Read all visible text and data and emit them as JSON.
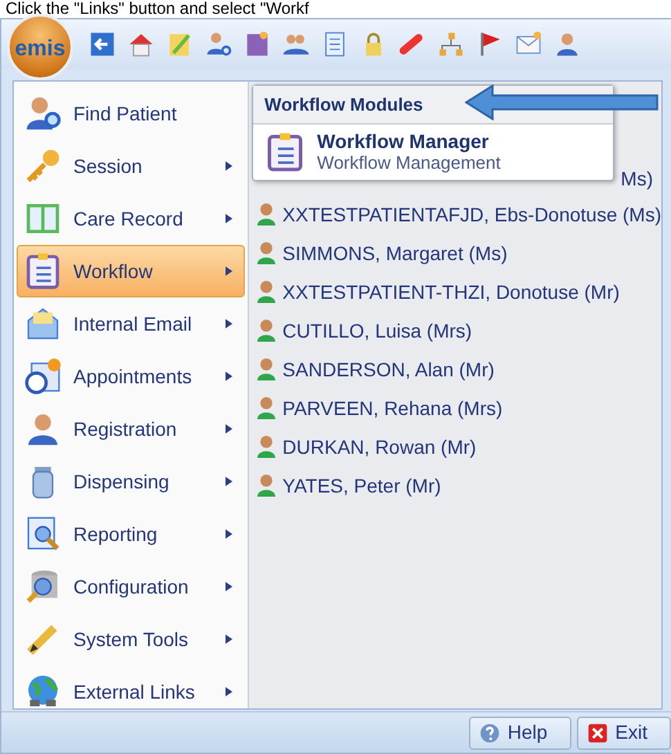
{
  "caption": "Click the \"Links\" button and select \"Workf",
  "logo": {
    "text": "emis"
  },
  "menu": [
    {
      "label": "Find Patient",
      "submenu": false,
      "selected": false
    },
    {
      "label": "Session",
      "submenu": true,
      "selected": false
    },
    {
      "label": "Care Record",
      "submenu": true,
      "selected": false
    },
    {
      "label": "Workflow",
      "submenu": true,
      "selected": true
    },
    {
      "label": "Internal Email",
      "submenu": true,
      "selected": false
    },
    {
      "label": "Appointments",
      "submenu": true,
      "selected": false
    },
    {
      "label": "Registration",
      "submenu": true,
      "selected": false
    },
    {
      "label": "Dispensing",
      "submenu": true,
      "selected": false
    },
    {
      "label": "Reporting",
      "submenu": true,
      "selected": false
    },
    {
      "label": "Configuration",
      "submenu": true,
      "selected": false
    },
    {
      "label": "System Tools",
      "submenu": true,
      "selected": false
    },
    {
      "label": "External Links",
      "submenu": true,
      "selected": false
    }
  ],
  "submenu": {
    "title": "Workflow Modules",
    "items": [
      {
        "title": "Workflow Manager",
        "subtitle": "Workflow Management"
      }
    ]
  },
  "patients": [
    "Ms)",
    "XXTESTPATIENTAFJD, Ebs-Donotuse (Ms)",
    "SIMMONS, Margaret (Ms)",
    "XXTESTPATIENT-THZI, Donotuse (Mr)",
    "CUTILLO, Luisa (Mrs)",
    "SANDERSON, Alan (Mr)",
    "PARVEEN, Rehana (Mrs)",
    "DURKAN, Rowan (Mr)",
    "YATES, Peter (Mr)"
  ],
  "footer_buttons": [
    {
      "kind": "help",
      "label": "Help"
    },
    {
      "kind": "exit",
      "label": "Exit"
    }
  ]
}
